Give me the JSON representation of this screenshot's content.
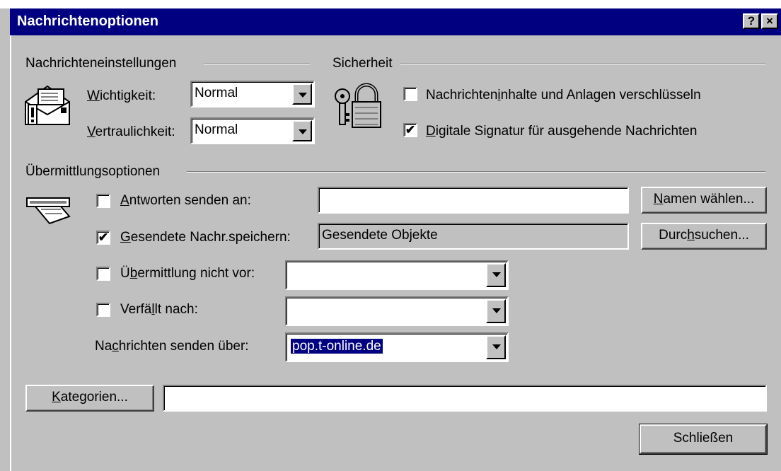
{
  "window": {
    "title": "Nachrichtenoptionen",
    "help_button": "?",
    "close_button": "×"
  },
  "message_settings": {
    "group_label": "Nachrichteneinstellungen",
    "importance": {
      "label_u": "W",
      "label_rest": "ichtigkeit:",
      "value": "Normal"
    },
    "sensitivity": {
      "label_u": "V",
      "label_rest": "ertraulichkeit:",
      "value": "Normal"
    }
  },
  "security": {
    "group_label": "Sicherheit",
    "encrypt": {
      "label_pre": "Nachrichten",
      "label_u": "i",
      "label_post": "nhalte und Anlagen verschlüsseln",
      "checked": false
    },
    "sign": {
      "label_u": "D",
      "label_rest": "igitale Signatur für ausgehende Nachrichten",
      "checked": true,
      "mark": "✔"
    }
  },
  "delivery": {
    "group_label": "Übermittlungsoptionen",
    "reply_to": {
      "label_u": "A",
      "label_rest": "ntworten senden an:",
      "checked": false,
      "value": ""
    },
    "select_names_button": {
      "label_u": "N",
      "label_rest": "amen wählen..."
    },
    "save_sent": {
      "label_u": "G",
      "label_rest": "esendete Nachr.speichern:",
      "checked": true,
      "mark": "✔",
      "value": "Gesendete Objekte"
    },
    "browse_button": {
      "label_pre": "Durc",
      "label_u": "h",
      "label_post": "suchen..."
    },
    "defer": {
      "label_pre": "Ü",
      "label_u": "b",
      "label_post": "ermittlung nicht vor:",
      "checked": false,
      "value": ""
    },
    "expires": {
      "label_pre": "Verfä",
      "label_u": "l",
      "label_post": "lt nach:",
      "checked": false,
      "value": ""
    },
    "send_via": {
      "label_pre": "Na",
      "label_u": "c",
      "label_post": "hrichten senden über:",
      "value": "pop.t-online.de"
    }
  },
  "categories": {
    "button": {
      "label_u": "K",
      "label_rest": "ategorien..."
    },
    "value": ""
  },
  "close_dialog_button": {
    "label": "Schließen"
  }
}
